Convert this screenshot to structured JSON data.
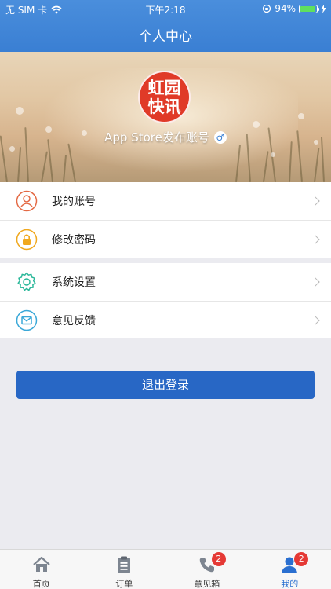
{
  "status_bar": {
    "carrier": "无 SIM 卡",
    "time": "下午2:18",
    "battery": "94%",
    "battery_level": 0.94
  },
  "nav": {
    "title": "个人中心"
  },
  "profile": {
    "logo_text": [
      "虹园",
      "快讯"
    ],
    "username": "App Store发布账号",
    "gender_symbol": "♂"
  },
  "menu_group_1": [
    {
      "label": "我的账号",
      "icon": "user-icon"
    },
    {
      "label": "修改密码",
      "icon": "lock-icon"
    }
  ],
  "menu_group_2": [
    {
      "label": "系统设置",
      "icon": "gear-icon"
    },
    {
      "label": "意见反馈",
      "icon": "mail-icon"
    }
  ],
  "logout": {
    "label": "退出登录",
    "color": "#2867c5"
  },
  "tabbar": {
    "tabs": [
      {
        "label": "首页",
        "icon": "home-icon"
      },
      {
        "label": "订单",
        "icon": "clipboard-icon"
      },
      {
        "label": "意见箱",
        "icon": "phone-icon",
        "badge": "2"
      },
      {
        "label": "我的",
        "icon": "person-icon",
        "badge": "2",
        "active": true
      }
    ],
    "active_color": "#2a6fd0"
  },
  "colors": {
    "header": "#3a7fd3",
    "badge": "#e53935",
    "background": "#ebebf0"
  }
}
